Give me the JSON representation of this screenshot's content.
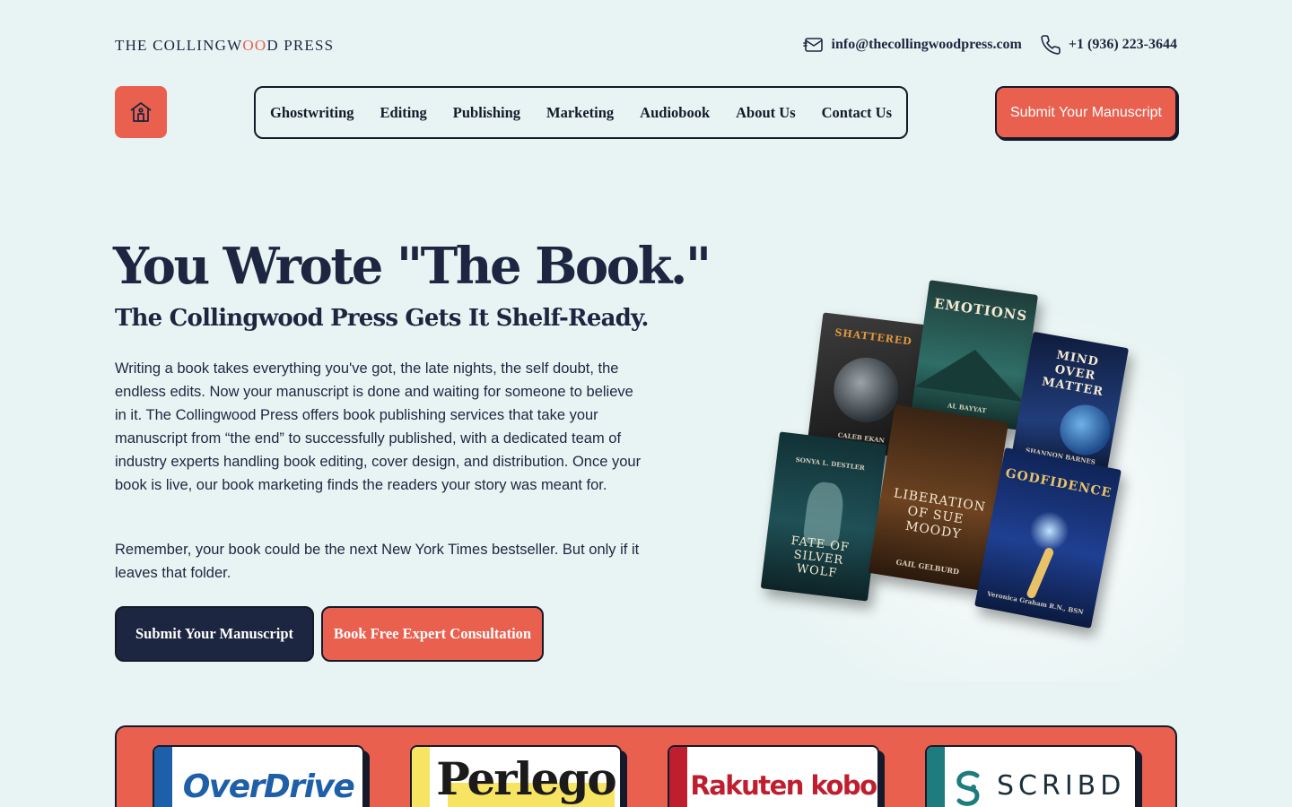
{
  "brand": {
    "logo_pre": "THE COLLINGW",
    "logo_oo": "OO",
    "logo_post": "D PRESS",
    "accent": "#e9604f",
    "navy": "#1d2640",
    "background": "#e8f4f3"
  },
  "contacts": {
    "email": "info@thecollingwoodpress.com",
    "phone": "+1 (936) 223-3644"
  },
  "nav": {
    "items": [
      "Ghostwriting",
      "Editing",
      "Publishing",
      "Marketing",
      "Audiobook",
      "About Us",
      "Contact Us"
    ],
    "cta": "Submit Your Manuscript"
  },
  "hero": {
    "title": "You Wrote \"The Book.\"",
    "subtitle": "The Collingwood Press Gets It Shelf-Ready.",
    "paragraph1": "Writing a book takes everything you've got, the late nights, the self doubt, the endless edits. Now your manuscript is done and waiting for someone to believe in it. The Collingwood Press offers book publishing services that take your manuscript from “the end” to successfully published, with a dedicated team of industry experts handling book editing, cover design, and distribution. Once your book is live, our book marketing finds the readers your story was meant for.",
    "paragraph2": "Remember, your book could be the next New York Times bestseller. But only if it leaves that folder.",
    "primary_button": "Submit Your Manuscript",
    "secondary_button": "Book Free Expert Consultation"
  },
  "books": [
    {
      "title": "SHATTERED",
      "author": "CALEB EKAN"
    },
    {
      "title": "EMOTIONS",
      "author": "AL BAYYAT"
    },
    {
      "title": "MIND OVER MATTER",
      "author": "SHANNON BARNES"
    },
    {
      "title": "FATE OF SILVER WOLF",
      "author": "SONYA L. DESTLER"
    },
    {
      "title": "LIBERATION OF SUE MOODY",
      "author": "GAIL GELBURD"
    },
    {
      "title": "GODFIDENCE",
      "author": "Veronica Graham R.N., BSN"
    }
  ],
  "partners": [
    {
      "name": "OverDrive",
      "color": "#1d5fa8"
    },
    {
      "name": "Perlego",
      "color": "#f7e463"
    },
    {
      "name": "Rakuten kobo",
      "color": "#bf1e2e"
    },
    {
      "name": "SCRIBD",
      "color": "#1e7b7e"
    }
  ]
}
